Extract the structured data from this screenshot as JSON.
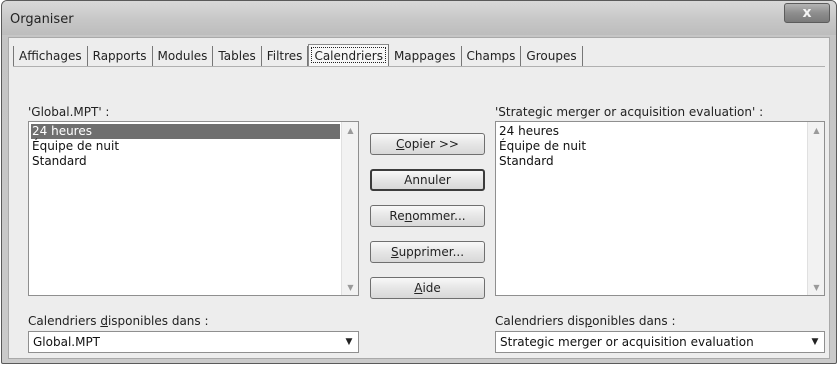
{
  "window": {
    "title": "Organiser",
    "close_symbol": "x"
  },
  "tabs": [
    {
      "label": "Affichages"
    },
    {
      "label": "Rapports"
    },
    {
      "label": "Modules"
    },
    {
      "label": "Tables"
    },
    {
      "label": "Filtres"
    },
    {
      "label": "Calendriers",
      "active": true
    },
    {
      "label": "Mappages"
    },
    {
      "label": "Champs"
    },
    {
      "label": "Groupes"
    }
  ],
  "left_panel": {
    "header": "'Global.MPT' :",
    "items": [
      "24 heures",
      "Équipe de nuit",
      "Standard"
    ],
    "selected_index": 0,
    "source_label_before": "Calendriers ",
    "source_label_accel": "d",
    "source_label_after": "isponibles dans :",
    "source_value": "Global.MPT"
  },
  "right_panel": {
    "header": "'Strategic merger or acquisition evaluation' :",
    "items": [
      "24 heures",
      "Équipe de nuit",
      "Standard"
    ],
    "source_label_before": "Calendriers dis",
    "source_label_accel": "p",
    "source_label_after": "onibles dans :",
    "source_value": "Strategic merger or acquisition evaluation"
  },
  "buttons": {
    "copy": {
      "accel": "C",
      "rest": "opier >>"
    },
    "cancel": {
      "label": "Annuler"
    },
    "rename": {
      "before": "Re",
      "accel": "n",
      "rest": "ommer..."
    },
    "delete": {
      "accel": "S",
      "rest": "upprimer..."
    },
    "help": {
      "accel": "A",
      "rest": "ide"
    }
  },
  "icons": {
    "close": "close-icon",
    "scroll_up": "scroll-up-arrow-icon",
    "scroll_down": "scroll-down-arrow-icon",
    "dropdown": "chevron-down-icon"
  },
  "colors": {
    "selection": "#6f6f6f",
    "client_bg": "#ededed"
  }
}
